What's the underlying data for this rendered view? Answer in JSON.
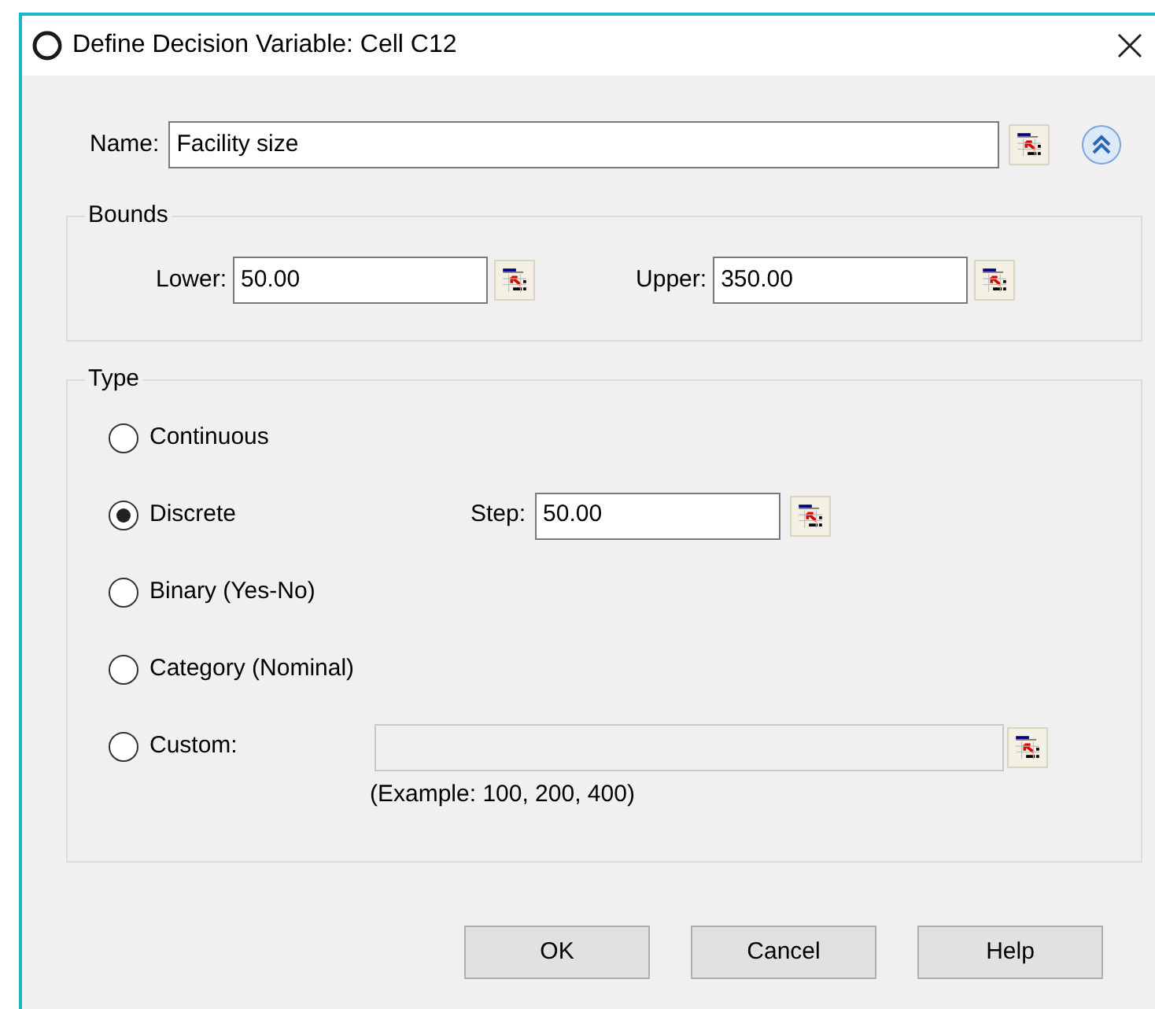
{
  "window": {
    "title": "Define Decision Variable: Cell C12"
  },
  "name": {
    "label": "Name:",
    "value": "Facility size"
  },
  "bounds": {
    "title": "Bounds",
    "fields": [
      {
        "label": "Lower:",
        "value": "50.00"
      },
      {
        "label": "Upper:",
        "value": "350.00"
      }
    ]
  },
  "type": {
    "title": "Type",
    "options": [
      {
        "kind": "plain",
        "label": "Continuous",
        "selected": false
      },
      {
        "kind": "step",
        "label": "Discrete",
        "selected": true,
        "field": {
          "label": "Step:",
          "value": "50.00"
        }
      },
      {
        "kind": "plain",
        "label": "Binary (Yes-No)",
        "selected": false
      },
      {
        "kind": "plain",
        "label": "Category (Nominal)",
        "selected": false
      },
      {
        "kind": "custom",
        "label": "Custom:",
        "selected": false,
        "field": {
          "disabled": true
        },
        "hint": "(Example:  100, 200, 400)"
      }
    ]
  },
  "buttons": [
    "OK",
    "Cancel",
    "Help"
  ]
}
